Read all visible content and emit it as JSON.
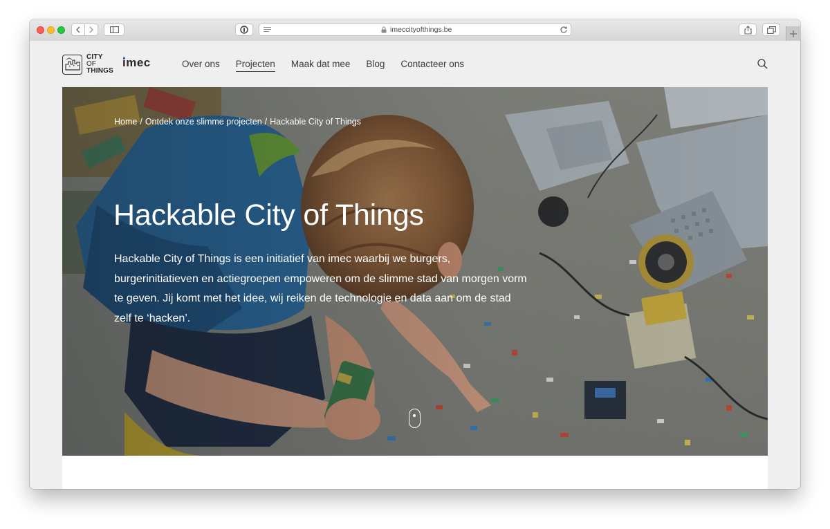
{
  "browser": {
    "url": "imeccityofthings.be"
  },
  "header": {
    "logo": {
      "line1": "CITY",
      "line2": "OF",
      "line3": "THINGS",
      "partner": "imec"
    },
    "nav": [
      {
        "label": "Over ons",
        "active": false
      },
      {
        "label": "Projecten",
        "active": true
      },
      {
        "label": "Maak dat mee",
        "active": false
      },
      {
        "label": "Blog",
        "active": false
      },
      {
        "label": "Contacteer ons",
        "active": false
      }
    ]
  },
  "hero": {
    "breadcrumb": [
      "Home",
      "Ontdek onze slimme projecten",
      "Hackable City of Things"
    ],
    "breadcrumb_separator": "/",
    "title": "Hackable City of Things",
    "description": "Hackable City of Things is een initiatief van imec waarbij we burgers, burgerinitiatieven en actiegroepen empoweren om de slimme stad van morgen vorm te geven. Jij komt met het idee, wij reiken de technologie en data aan om de stad zelf te ‘hacken’."
  },
  "icons": {
    "back": "chevron-left-icon",
    "forward": "chevron-right-icon",
    "sidebar": "sidebar-icon",
    "reader": "reader-icon",
    "lock": "lock-icon",
    "reload": "reload-icon",
    "share": "share-icon",
    "tabs": "tabs-icon",
    "new_tab": "plus-icon",
    "search": "search-icon",
    "scroll": "scroll-mouse-icon"
  }
}
